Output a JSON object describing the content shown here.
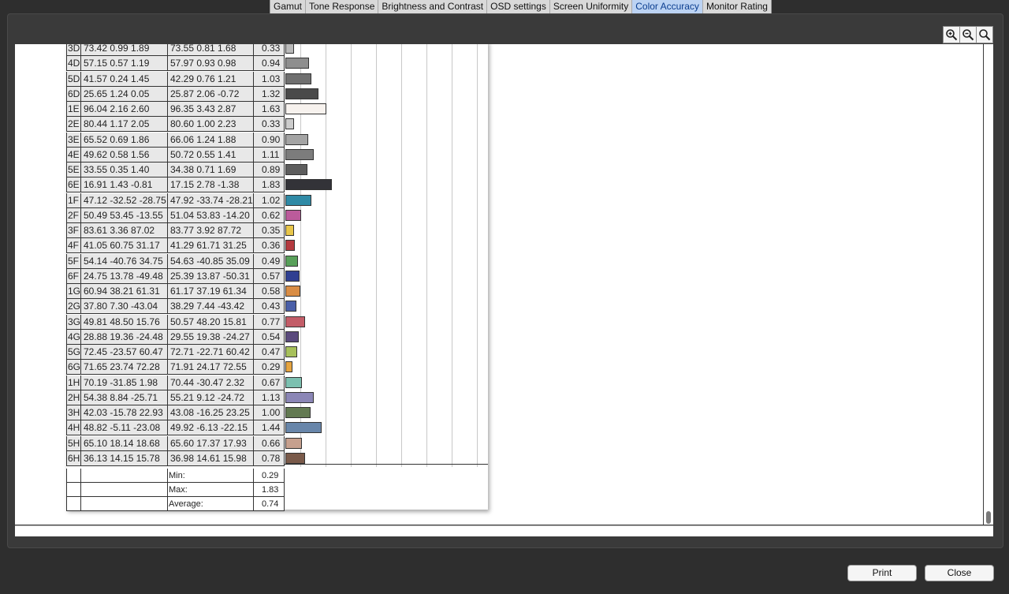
{
  "tabs": [
    {
      "label": "Gamut",
      "active": false
    },
    {
      "label": "Tone Response",
      "active": false
    },
    {
      "label": "Brightness and Contrast",
      "active": false
    },
    {
      "label": "OSD settings",
      "active": false
    },
    {
      "label": "Screen Uniformity",
      "active": false
    },
    {
      "label": "Color Accuracy",
      "active": true
    },
    {
      "label": "Monitor Rating",
      "active": false
    }
  ],
  "zoom_controls": [
    {
      "icon": "zoom-in-icon"
    },
    {
      "icon": "zoom-out-icon"
    },
    {
      "icon": "zoom-reset-icon"
    }
  ],
  "table": {
    "rows": [
      {
        "id": "3D",
        "measured": "73.42  0.99  1.89",
        "reference": "73.55  0.81  1.68",
        "delta_e": "0.33",
        "color": "#b9b9b9"
      },
      {
        "id": "4D",
        "measured": "57.15  0.57  1.19",
        "reference": "57.97  0.93  0.98",
        "delta_e": "0.94",
        "color": "#8e8e8e"
      },
      {
        "id": "5D",
        "measured": "41.57  0.24  1.45",
        "reference": "42.29  0.76  1.21",
        "delta_e": "1.03",
        "color": "#6f6f6f"
      },
      {
        "id": "6D",
        "measured": "25.65  1.24  0.05",
        "reference": "25.87  2.06 -0.72",
        "delta_e": "1.32",
        "color": "#4a4a4a"
      },
      {
        "id": "1E",
        "measured": "96.04  2.16  2.60",
        "reference": "96.35  3.43  2.87",
        "delta_e": "1.63",
        "color": "#f7f2ee"
      },
      {
        "id": "2E",
        "measured": "80.44  1.17  2.05",
        "reference": "80.60  1.00  2.23",
        "delta_e": "0.33",
        "color": "#cccccc"
      },
      {
        "id": "3E",
        "measured": "65.52  0.69  1.86",
        "reference": "66.06  1.24  1.88",
        "delta_e": "0.90",
        "color": "#a4a4a4"
      },
      {
        "id": "4E",
        "measured": "49.62  0.58  1.56",
        "reference": "50.72  0.55  1.41",
        "delta_e": "1.11",
        "color": "#7c7c7c"
      },
      {
        "id": "5E",
        "measured": "33.55  0.35  1.40",
        "reference": "34.38  0.71  1.69",
        "delta_e": "0.89",
        "color": "#5d5d5d"
      },
      {
        "id": "6E",
        "measured": "16.91  1.43 -0.81",
        "reference": "17.15  2.78 -1.38",
        "delta_e": "1.83",
        "color": "#333338"
      },
      {
        "id": "1F",
        "measured": "47.12 -32.52 -28.75",
        "reference": "47.92 -33.74 -28.21",
        "delta_e": "1.02",
        "color": "#2f8aa6"
      },
      {
        "id": "2F",
        "measured": "50.49  53.45 -13.55",
        "reference": "51.04  53.83 -14.20",
        "delta_e": "0.62",
        "color": "#bb5b9b"
      },
      {
        "id": "3F",
        "measured": "83.61  3.36  87.02",
        "reference": "83.77  3.92  87.72",
        "delta_e": "0.35",
        "color": "#e8c64a"
      },
      {
        "id": "4F",
        "measured": "41.05  60.75  31.17",
        "reference": "41.29  61.71  31.25",
        "delta_e": "0.36",
        "color": "#b43a3f"
      },
      {
        "id": "5F",
        "measured": "54.14 -40.76  34.75",
        "reference": "54.63 -40.85  35.09",
        "delta_e": "0.49",
        "color": "#58a05a"
      },
      {
        "id": "6F",
        "measured": "24.75  13.78 -49.48",
        "reference": "25.39  13.87 -50.31",
        "delta_e": "0.57",
        "color": "#2f3f91"
      },
      {
        "id": "1G",
        "measured": "60.94  38.21  61.31",
        "reference": "61.17  37.19  61.34",
        "delta_e": "0.58",
        "color": "#d98d45"
      },
      {
        "id": "2G",
        "measured": "37.80  7.30 -43.04",
        "reference": "38.29  7.44 -43.42",
        "delta_e": "0.43",
        "color": "#4a5fa8"
      },
      {
        "id": "3G",
        "measured": "49.81  48.50  15.76",
        "reference": "50.57  48.20  15.81",
        "delta_e": "0.77",
        "color": "#c35d68"
      },
      {
        "id": "4G",
        "measured": "28.88  19.36 -24.48",
        "reference": "29.55  19.38 -24.27",
        "delta_e": "0.54",
        "color": "#5a4a7d"
      },
      {
        "id": "5G",
        "measured": "72.45 -23.57  60.47",
        "reference": "72.71 -22.71  60.42",
        "delta_e": "0.47",
        "color": "#a7c05b"
      },
      {
        "id": "6G",
        "measured": "71.65  23.74  72.28",
        "reference": "71.91  24.17  72.55",
        "delta_e": "0.29",
        "color": "#e5a440"
      },
      {
        "id": "1H",
        "measured": "70.19 -31.85  1.98",
        "reference": "70.44 -30.47  2.32",
        "delta_e": "0.67",
        "color": "#7cc0b0"
      },
      {
        "id": "2H",
        "measured": "54.38  8.84 -25.71",
        "reference": "55.21  9.12 -24.72",
        "delta_e": "1.13",
        "color": "#8b86b6"
      },
      {
        "id": "3H",
        "measured": "42.03 -15.78  22.93",
        "reference": "43.08 -16.25  23.25",
        "delta_e": "1.00",
        "color": "#637a52"
      },
      {
        "id": "4H",
        "measured": "48.82 -5.11 -23.08",
        "reference": "49.92 -6.13 -22.15",
        "delta_e": "1.44",
        "color": "#6886aa"
      },
      {
        "id": "5H",
        "measured": "65.10  18.14  18.68",
        "reference": "65.60  17.37  17.93",
        "delta_e": "0.66",
        "color": "#c6a08e"
      },
      {
        "id": "6H",
        "measured": "36.13  14.15  15.78",
        "reference": "36.98  14.61  15.98",
        "delta_e": "0.78",
        "color": "#7a5a4a"
      }
    ],
    "summary": [
      {
        "label": "Min:",
        "value": "0.29"
      },
      {
        "label": "Max:",
        "value": "1.83"
      },
      {
        "label": "Average:",
        "value": "0.74"
      }
    ]
  },
  "buttons": {
    "print_label": "Print",
    "close_label": "Close"
  }
}
